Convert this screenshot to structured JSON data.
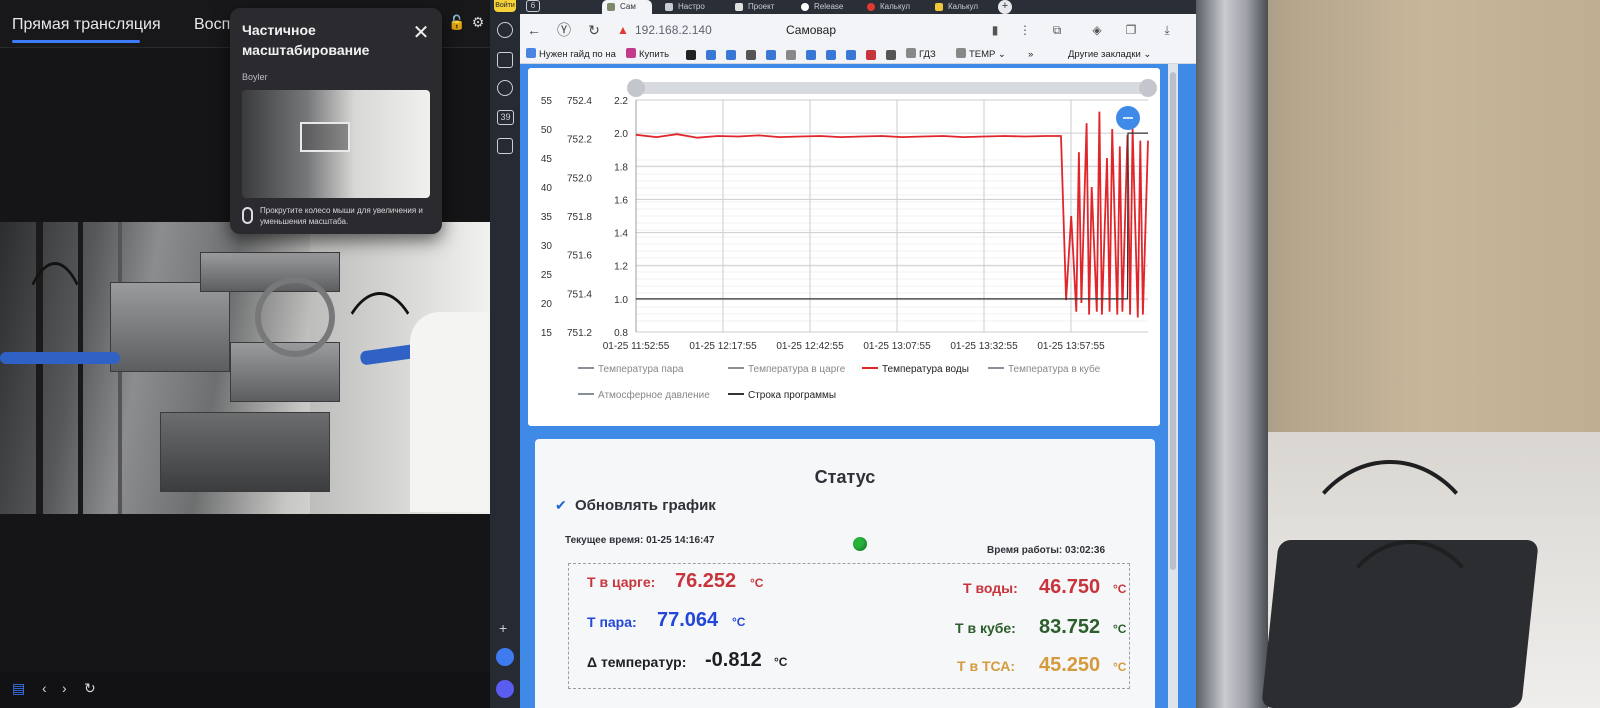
{
  "video_app": {
    "tabs": [
      "Прямая трансляция",
      "Восп"
    ],
    "popover": {
      "title": "Частичное масштабирование",
      "subtitle": "Boyler",
      "hint": "Прокрутите колесо мыши для увеличения и уменьшения масштаба.",
      "close_icon": "close-icon"
    }
  },
  "browser": {
    "login_badge": "Войти",
    "sidebar_badge": "39",
    "tab_count": "6",
    "tabs": [
      "Сам",
      "Настро",
      "Проект",
      "Release",
      "Калькул",
      "Калькул"
    ],
    "url": "192.168.2.140",
    "page_title": "Самовар",
    "bookmarks": [
      "Нужен гайд по на",
      "Купить",
      "ГДЗ",
      "TEMP",
      "Другие закладки"
    ]
  },
  "chart_data": {
    "type": "line",
    "title": "",
    "x_labels": [
      "01-25 11:52:55",
      "01-25 12:17:55",
      "01-25 12:42:55",
      "01-25 13:07:55",
      "01-25 13:32:55",
      "01-25 13:57:55"
    ],
    "axes": {
      "left_outer": {
        "ticks": [
          "55",
          "50",
          "45",
          "40",
          "35",
          "30",
          "25",
          "20",
          "15"
        ],
        "ylim": [
          15,
          55
        ]
      },
      "left_middle": {
        "ticks": [
          "752.4",
          "752.2",
          "752.0",
          "751.8",
          "751.6",
          "751.4",
          "751.2"
        ],
        "ylim": [
          751.2,
          752.4
        ]
      },
      "left_inner": {
        "ticks": [
          "2.2",
          "2.0",
          "1.8",
          "1.6",
          "1.4",
          "1.2",
          "1.0",
          "0.8"
        ],
        "ylim": [
          0.8,
          2.2
        ]
      }
    },
    "legend": [
      "Температура пара",
      "Температура в царге",
      "Температура воды",
      "Температура в кубе",
      "Атмосферное давление",
      "Строка программы"
    ],
    "legend_colors": [
      "#8a8f97",
      "#8a8f97",
      "#e0262b",
      "#8a8f97",
      "#8a8f97",
      "#333333"
    ],
    "series": [
      {
        "name": "Температура воды",
        "color": "#e0262b",
        "x": [
          0,
          0.04,
          0.08,
          0.12,
          0.16,
          0.2,
          0.24,
          0.28,
          0.32,
          0.36,
          0.4,
          0.44,
          0.48,
          0.52,
          0.56,
          0.6,
          0.64,
          0.68,
          0.72,
          0.76,
          0.8,
          0.83,
          0.84,
          0.85,
          0.86,
          0.865,
          0.87,
          0.88,
          0.885,
          0.89,
          0.9,
          0.905,
          0.91,
          0.92,
          0.925,
          0.93,
          0.94,
          0.945,
          0.95,
          0.96,
          0.965,
          0.97,
          0.98,
          0.985,
          0.99,
          1.0
        ],
        "y": [
          49,
          48.6,
          49.1,
          48.5,
          48.8,
          48.7,
          48.9,
          48.6,
          48.7,
          48.8,
          48.6,
          48.7,
          48.8,
          48.6,
          48.7,
          48.8,
          48.6,
          48.7,
          48.8,
          48.7,
          48.8,
          48.8,
          20.5,
          35,
          18.5,
          46,
          20,
          51,
          18,
          40,
          18.5,
          53,
          18,
          45,
          18.5,
          50,
          18,
          47,
          18.5,
          49,
          18,
          50,
          17.5,
          48,
          18,
          48
        ]
      },
      {
        "name": "Строка программы",
        "color": "#333333",
        "x": [
          0,
          0.96,
          0.961,
          1.0
        ],
        "y": [
          1.0,
          1.0,
          2.0,
          2.0
        ]
      }
    ],
    "legend_position": "bottom",
    "grid": true
  },
  "status": {
    "title": "Статус",
    "refresh_label": "Обновлять график",
    "refresh_checked": true,
    "current_time": "Текущее время: 01-25 14:16:47",
    "uptime": "Время работы: 03:02:36",
    "readings": {
      "t_tsarga": {
        "label": "Т в царге:",
        "value": "76.252",
        "unit": "°C",
        "color": "#c8343b"
      },
      "t_water": {
        "label": "Т воды:",
        "value": "46.750",
        "unit": "°C",
        "color": "#c8343b"
      },
      "t_steam": {
        "label": "Т пара:",
        "value": "77.064",
        "unit": "°C",
        "color": "#2346d8"
      },
      "t_cube": {
        "label": "Т в кубе:",
        "value": "83.752",
        "unit": "°C",
        "color": "#2b5e2b"
      },
      "delta": {
        "label": "Δ температур:",
        "value": "-0.812",
        "unit": "°C",
        "color": "#1e1f22"
      },
      "t_tsa": {
        "label": "Т в ТСА:",
        "value": "45.250",
        "unit": "°C",
        "color": "#d49a3c"
      }
    }
  }
}
